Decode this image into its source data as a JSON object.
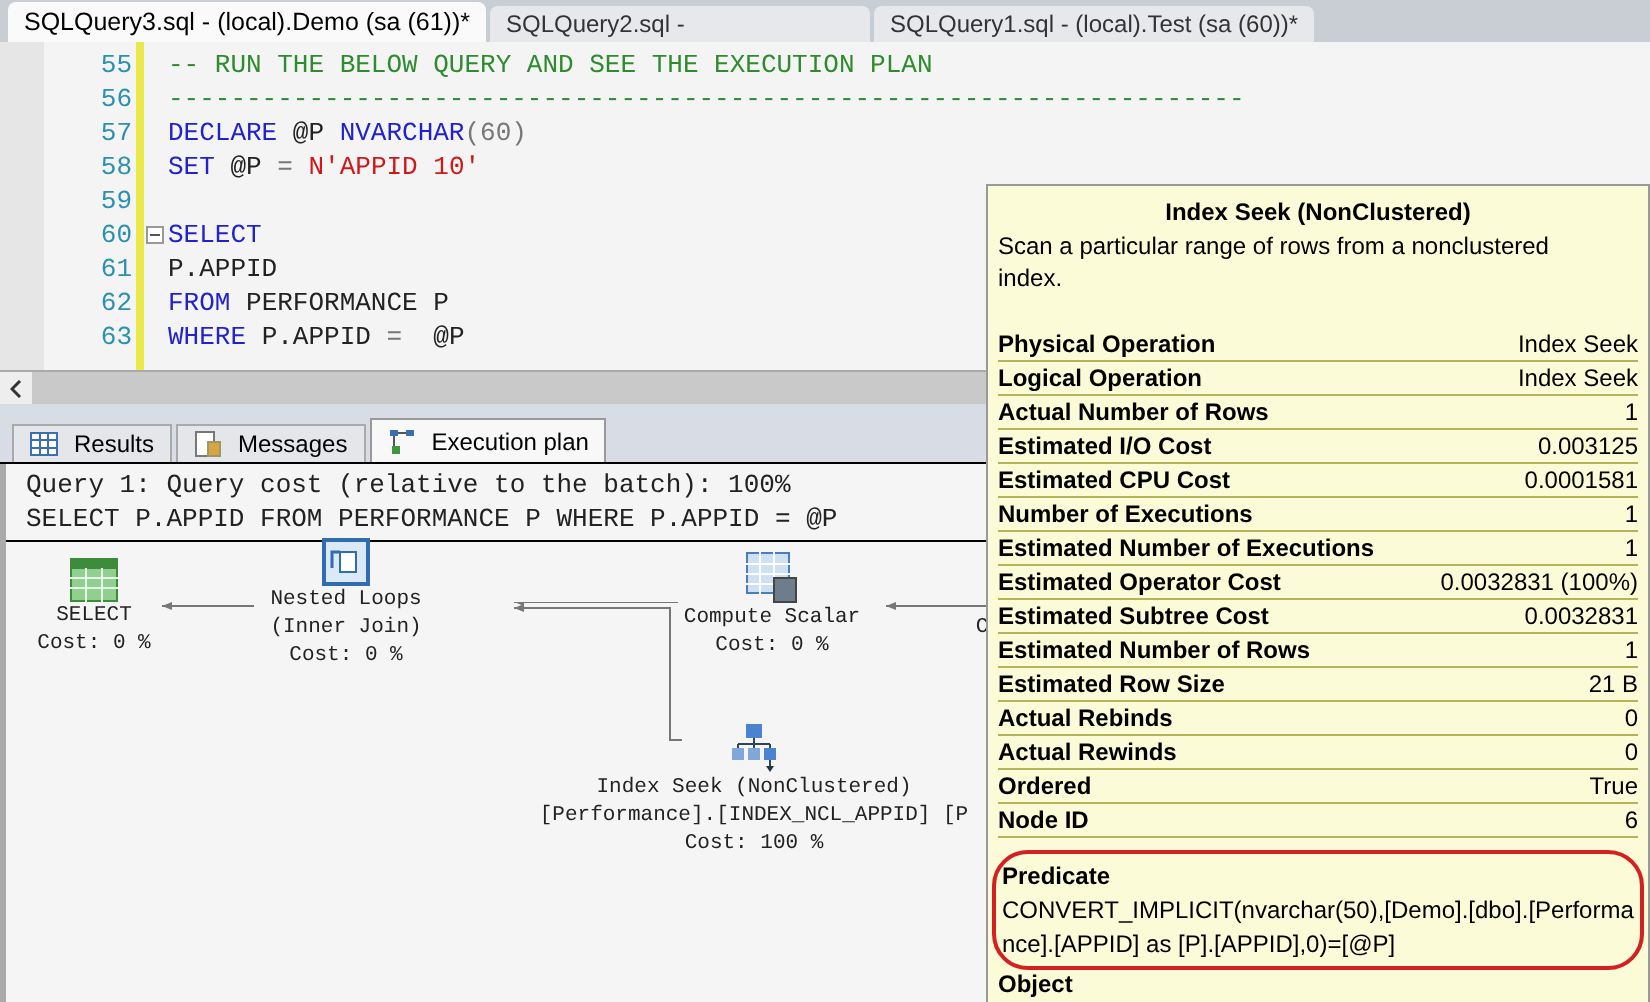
{
  "doc_tabs": [
    {
      "label": "SQLQuery3.sql - (local).Demo (sa (61))*",
      "selected": true
    },
    {
      "label": "SQLQuery2.sql -",
      "selected": false
    },
    {
      "label": "SQLQuery1.sql - (local).Test (sa (60))*",
      "selected": false
    }
  ],
  "editor": {
    "lines": [
      {
        "number": "55",
        "fold": false,
        "segments": [
          {
            "kind": "comment",
            "text": "-- RUN THE BELOW QUERY AND SEE THE EXECUTION PLAN"
          }
        ]
      },
      {
        "number": "56",
        "fold": false,
        "segments": [
          {
            "kind": "comment",
            "text": "---------------------------------------------------------------------"
          }
        ]
      },
      {
        "number": "57",
        "fold": false,
        "segments": [
          {
            "kind": "keyword",
            "text": "DECLARE"
          },
          {
            "kind": "plain",
            "text": " @P "
          },
          {
            "kind": "keyword",
            "text": "NVARCHAR"
          },
          {
            "kind": "punct",
            "text": "(60)"
          }
        ]
      },
      {
        "number": "58",
        "fold": false,
        "segments": [
          {
            "kind": "keyword",
            "text": "SET"
          },
          {
            "kind": "plain",
            "text": " @P "
          },
          {
            "kind": "punct",
            "text": "="
          },
          {
            "kind": "string",
            "text": " N'APPID 10'"
          }
        ]
      },
      {
        "number": "59",
        "fold": false
      },
      {
        "number": "60",
        "fold": true,
        "segments": [
          {
            "kind": "keyword",
            "text": "SELECT"
          }
        ]
      },
      {
        "number": "61",
        "fold": false,
        "segments": [
          {
            "kind": "plain",
            "text": "P.APPID"
          }
        ]
      },
      {
        "number": "62",
        "fold": false,
        "segments": [
          {
            "kind": "keyword",
            "text": "FROM"
          },
          {
            "kind": "plain",
            "text": " PERFORMANCE P"
          }
        ]
      },
      {
        "number": "63",
        "fold": false,
        "segments": [
          {
            "kind": "keyword",
            "text": "WHERE"
          },
          {
            "kind": "plain",
            "text": " P.APPID "
          },
          {
            "kind": "punct",
            "text": "="
          },
          {
            "kind": "plain",
            "text": "  @P"
          }
        ]
      }
    ]
  },
  "result_tabs": [
    {
      "label": "Results",
      "kind": "grid",
      "selected": false
    },
    {
      "label": "Messages",
      "kind": "messages",
      "selected": false
    },
    {
      "label": "Execution plan",
      "kind": "plan",
      "selected": true
    }
  ],
  "plan_header": [
    "Query 1: Query cost (relative to the batch): 100%",
    "SELECT P.APPID FROM PERFORMANCE P WHERE P.APPID = @P"
  ],
  "plan_nodes": [
    {
      "kind": "select",
      "lines": [
        "SELECT",
        "Cost: 0 %"
      ]
    },
    {
      "kind": "loops",
      "lines": [
        "Nested Loops",
        "(Inner Join)",
        "Cost: 0 %"
      ]
    },
    {
      "kind": "compute",
      "lines": [
        "Compute Scalar",
        "Cost: 0 %"
      ]
    },
    {
      "kind": "cut",
      "lines": [
        "C"
      ]
    },
    {
      "kind": "seek",
      "lines": [
        "Index Seek (NonClustered)",
        "[Performance].[INDEX_NCL_APPID] [P",
        "Cost: 100 %"
      ]
    }
  ],
  "tooltip": {
    "title": "Index Seek (NonClustered)",
    "description": "Scan a particular range of rows from a nonclustered index.",
    "properties": [
      {
        "label": "Physical Operation",
        "value": "Index Seek"
      },
      {
        "label": "Logical Operation",
        "value": "Index Seek"
      },
      {
        "label": "Actual Number of Rows",
        "value": "1"
      },
      {
        "label": "Estimated I/O Cost",
        "value": "0.003125"
      },
      {
        "label": "Estimated CPU Cost",
        "value": "0.0001581"
      },
      {
        "label": "Number of Executions",
        "value": "1"
      },
      {
        "label": "Estimated Number of Executions",
        "value": "1"
      },
      {
        "label": "Estimated Operator Cost",
        "value": "0.0032831 (100%)"
      },
      {
        "label": "Estimated Subtree Cost",
        "value": "0.0032831"
      },
      {
        "label": "Estimated Number of Rows",
        "value": "1"
      },
      {
        "label": "Estimated Row Size",
        "value": "21 B"
      },
      {
        "label": "Actual Rebinds",
        "value": "0"
      },
      {
        "label": "Actual Rewinds",
        "value": "0"
      },
      {
        "label": "Ordered",
        "value": "True"
      },
      {
        "label": "Node ID",
        "value": "6"
      }
    ],
    "predicate_heading": "Predicate",
    "predicate": "CONVERT_IMPLICIT(nvarchar(50),[Demo].[dbo].[Performance].[APPID] as [P].[APPID],0)=[@P]",
    "next_heading": "Object"
  }
}
